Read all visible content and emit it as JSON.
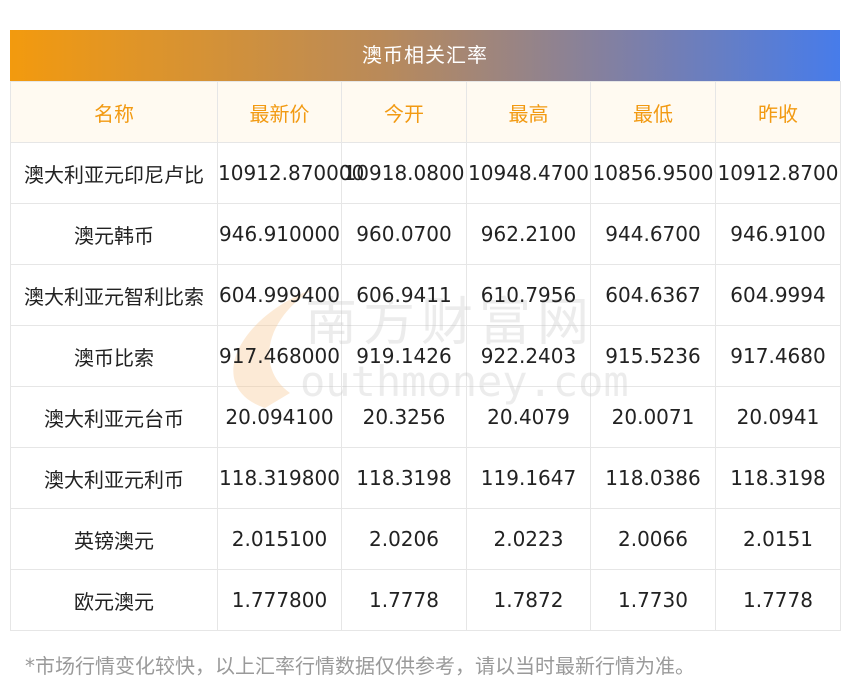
{
  "title": "澳币相关汇率",
  "columns": [
    "名称",
    "最新价",
    "今开",
    "最高",
    "最低",
    "昨收"
  ],
  "rows": [
    [
      "澳大利亚元印尼卢比",
      "10912.870000",
      "10918.0800",
      "10948.4700",
      "10856.9500",
      "10912.8700"
    ],
    [
      "澳元韩币",
      "946.910000",
      "960.0700",
      "962.2100",
      "944.6700",
      "946.9100"
    ],
    [
      "澳大利亚元智利比索",
      "604.999400",
      "606.9411",
      "610.7956",
      "604.6367",
      "604.9994"
    ],
    [
      "澳币比索",
      "917.468000",
      "919.1426",
      "922.2403",
      "915.5236",
      "917.4680"
    ],
    [
      "澳大利亚元台币",
      "20.094100",
      "20.3256",
      "20.4079",
      "20.0071",
      "20.0941"
    ],
    [
      "澳大利亚元利币",
      "118.319800",
      "118.3198",
      "119.1647",
      "118.0386",
      "118.3198"
    ],
    [
      "英镑澳元",
      "2.015100",
      "2.0206",
      "2.0223",
      "2.0066",
      "2.0151"
    ],
    [
      "欧元澳元",
      "1.777800",
      "1.7778",
      "1.7872",
      "1.7730",
      "1.7778"
    ]
  ],
  "watermark": {
    "cn": "南方财富网",
    "en": "outhmoney.com"
  },
  "note": "*市场行情变化较快，以上汇率行情数据仅供参考，请以当时最新行情为准。",
  "colors": {
    "header_text": "#f29a12",
    "header_bg": "#fffaf1",
    "title_gradient_start": "#f39a0e",
    "title_gradient_end": "#477cea"
  }
}
